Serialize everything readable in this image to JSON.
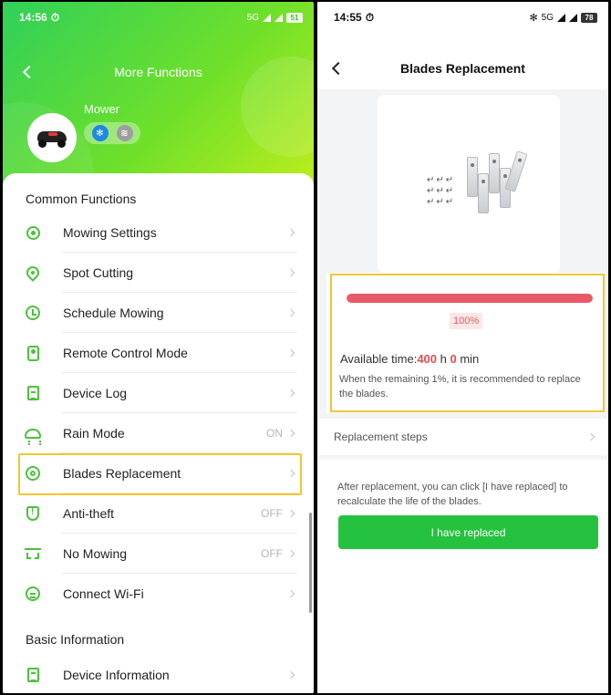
{
  "left": {
    "status": {
      "time": "14:56",
      "network": "5G",
      "battery": "51"
    },
    "nav": {
      "title": "More Functions"
    },
    "device": {
      "name": "Mower",
      "bluetooth_icon": "bluetooth-icon",
      "wifi_icon": "wifi-icon"
    },
    "sections": {
      "common_title": "Common Functions",
      "basic_title": "Basic Information"
    },
    "common_items": [
      {
        "label": "Mowing Settings",
        "value": "",
        "icon": "gear-icon"
      },
      {
        "label": "Spot Cutting",
        "value": "",
        "icon": "location-pin-icon"
      },
      {
        "label": "Schedule Mowing",
        "value": "",
        "icon": "clock-icon"
      },
      {
        "label": "Remote Control Mode",
        "value": "",
        "icon": "remote-control-icon"
      },
      {
        "label": "Device Log",
        "value": "",
        "icon": "log-document-icon"
      },
      {
        "label": "Rain Mode",
        "value": "ON",
        "icon": "rain-cloud-icon"
      },
      {
        "label": "Blades Replacement",
        "value": "",
        "icon": "blade-icon"
      },
      {
        "label": "Anti-theft",
        "value": "OFF",
        "icon": "shield-icon"
      },
      {
        "label": "No Mowing",
        "value": "OFF",
        "icon": "no-mowing-icon"
      },
      {
        "label": "Connect Wi-Fi",
        "value": "",
        "icon": "wifi-connect-icon"
      }
    ],
    "basic_items": [
      {
        "label": "Device Information",
        "value": "",
        "icon": "device-info-icon"
      }
    ],
    "highlight_color": "#f3c532",
    "accent": "#4cc13c"
  },
  "right": {
    "status": {
      "time": "14:55",
      "network": "5G",
      "battery": "78"
    },
    "nav": {
      "title": "Blades Replacement"
    },
    "progress": {
      "percent": 100,
      "label": "100%"
    },
    "available": {
      "prefix": "Available time:",
      "hours": "400",
      "h": " h ",
      "minutes": "0",
      "min": " min"
    },
    "note": "When the remaining 1%, it is recommended to replace the blades.",
    "steps_label": "Replacement steps",
    "after_note": "After replacement, you can click [I have replaced] to recalculate the life of the blades.",
    "button_label": "I have replaced",
    "colors": {
      "progress": "#e85a67",
      "button": "#24c23f"
    }
  }
}
